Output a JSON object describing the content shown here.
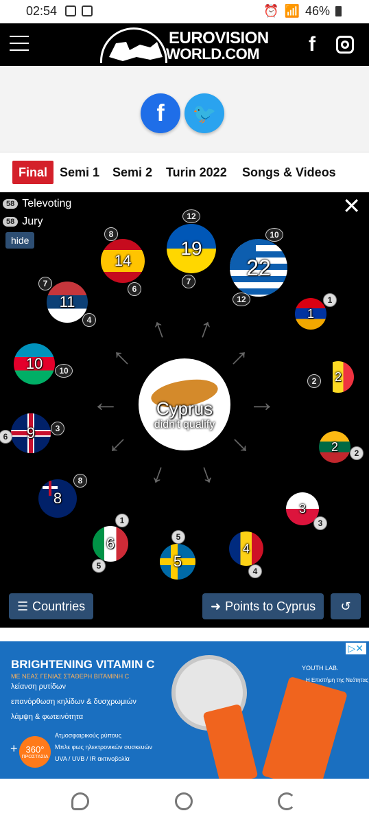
{
  "status_bar": {
    "time": "02:54",
    "battery": "46%"
  },
  "header": {
    "logo_line1": "EUROVISION",
    "logo_line2": "WORLD.COM"
  },
  "share": {
    "facebook_glyph": "f",
    "twitter_glyph": "🐦"
  },
  "tabs": [
    {
      "label": "Final",
      "active": true
    },
    {
      "label": "Semi 1"
    },
    {
      "label": "Semi 2"
    },
    {
      "label": "Turin 2022"
    },
    {
      "label": "Songs & Videos"
    }
  ],
  "legend": {
    "televoting_count": "58",
    "televoting_label": "Televoting",
    "jury_count": "58",
    "jury_label": "Jury",
    "hide_label": "hide"
  },
  "center": {
    "country": "Cyprus",
    "status": "didn't qualify"
  },
  "flags": [
    {
      "key": "spain",
      "score": "14",
      "televote": "8",
      "jury": "6"
    },
    {
      "key": "ukraine",
      "score": "19",
      "televote": "12",
      "jury": "7"
    },
    {
      "key": "greece",
      "score": "22",
      "televote": "10",
      "jury": "12"
    },
    {
      "key": "armenia",
      "score": "1",
      "televote": "1"
    },
    {
      "key": "serbia",
      "score": "11",
      "televote": "7",
      "jury": "4"
    },
    {
      "key": "azerbaijan",
      "score": "10",
      "jury": "10"
    },
    {
      "key": "belgium",
      "score": "2",
      "jury": "2"
    },
    {
      "key": "uk",
      "score": "9",
      "televote": "6",
      "jury": "3"
    },
    {
      "key": "lithuania",
      "score": "2",
      "televote": "2"
    },
    {
      "key": "australia",
      "score": "8",
      "jury": "8"
    },
    {
      "key": "poland",
      "score": "3",
      "televote": "3"
    },
    {
      "key": "italy",
      "score": "6",
      "televote": "1",
      "jury": "5"
    },
    {
      "key": "sweden",
      "score": "5",
      "televote": "5"
    },
    {
      "key": "romania",
      "score": "4",
      "jury": "4"
    }
  ],
  "buttons": {
    "countries": "Countries",
    "points_to": "Points to Cyprus"
  },
  "ad": {
    "headline": "BRIGHTENING VITAMIN C",
    "subhead": "ΜΕ ΝΕΑΣ ΓΕΝΙΑΣ ΣΤΑΘΕΡΗ ΒΙΤΑΜΙΝΗ C",
    "bullets": [
      "λείανση ρυτίδων",
      "επανόρθωση κηλίδων & δυσχρωμιών",
      "λάμψη & φωτεινότητα"
    ],
    "badge_number": "360°",
    "badge_text": "ΠΡΟΣΤΑΣΙΑ",
    "small_lines": [
      "Ατμοσφαιρικούς ρύπους",
      "Μπλε φως ηλεκτρονικών συσκευών",
      "UVA / UVB / IR ακτινοβολία"
    ],
    "brand": "YOUTH LAB.",
    "tagline": "Η Επιστήμη της Νεότητας"
  }
}
